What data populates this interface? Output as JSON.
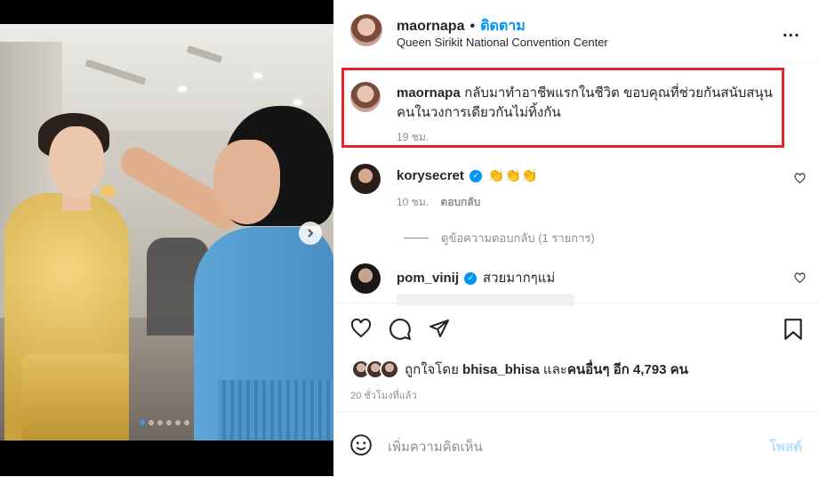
{
  "post": {
    "username": "maornapa",
    "separator": "•",
    "follow_label": "ติดตาม",
    "location": "Queen Sirikit National Convention Center",
    "more_label": "..."
  },
  "caption": {
    "username": "maornapa",
    "line1": "กลับมาทำอาชีพแรกในชีวิต ขอบคุณที่ช่วยกันสนับสนุน",
    "line2": "คนในวงการเดียวกันไม่ทิ้งกัน",
    "time": "19 ชม."
  },
  "comments": [
    {
      "username": "korysecret",
      "text": "👏👏👏",
      "time": "10 ชม.",
      "reply_label": "ตอบกลับ"
    },
    {
      "username": "pom_vinij",
      "text": "สวยมากๆแม่"
    }
  ],
  "view_replies_label": "ดูข้อความตอบกลับ (1 รายการ)",
  "likes": {
    "prefix": "ถูกใจโดย",
    "user": "bhisa_bhisa",
    "mid": "และ",
    "others": "คนอื่นๆ อีก 4,793 คน"
  },
  "time_ago": "20 ชั่วโมงที่แล้ว",
  "add_comment": {
    "placeholder": "เพิ่มความคิดเห็น",
    "post_label": "โพสต์"
  },
  "carousel": {
    "slide_count": 6,
    "active_index": 0
  },
  "colors": {
    "accent": "#0095f6",
    "highlight_border": "#e3262d"
  }
}
